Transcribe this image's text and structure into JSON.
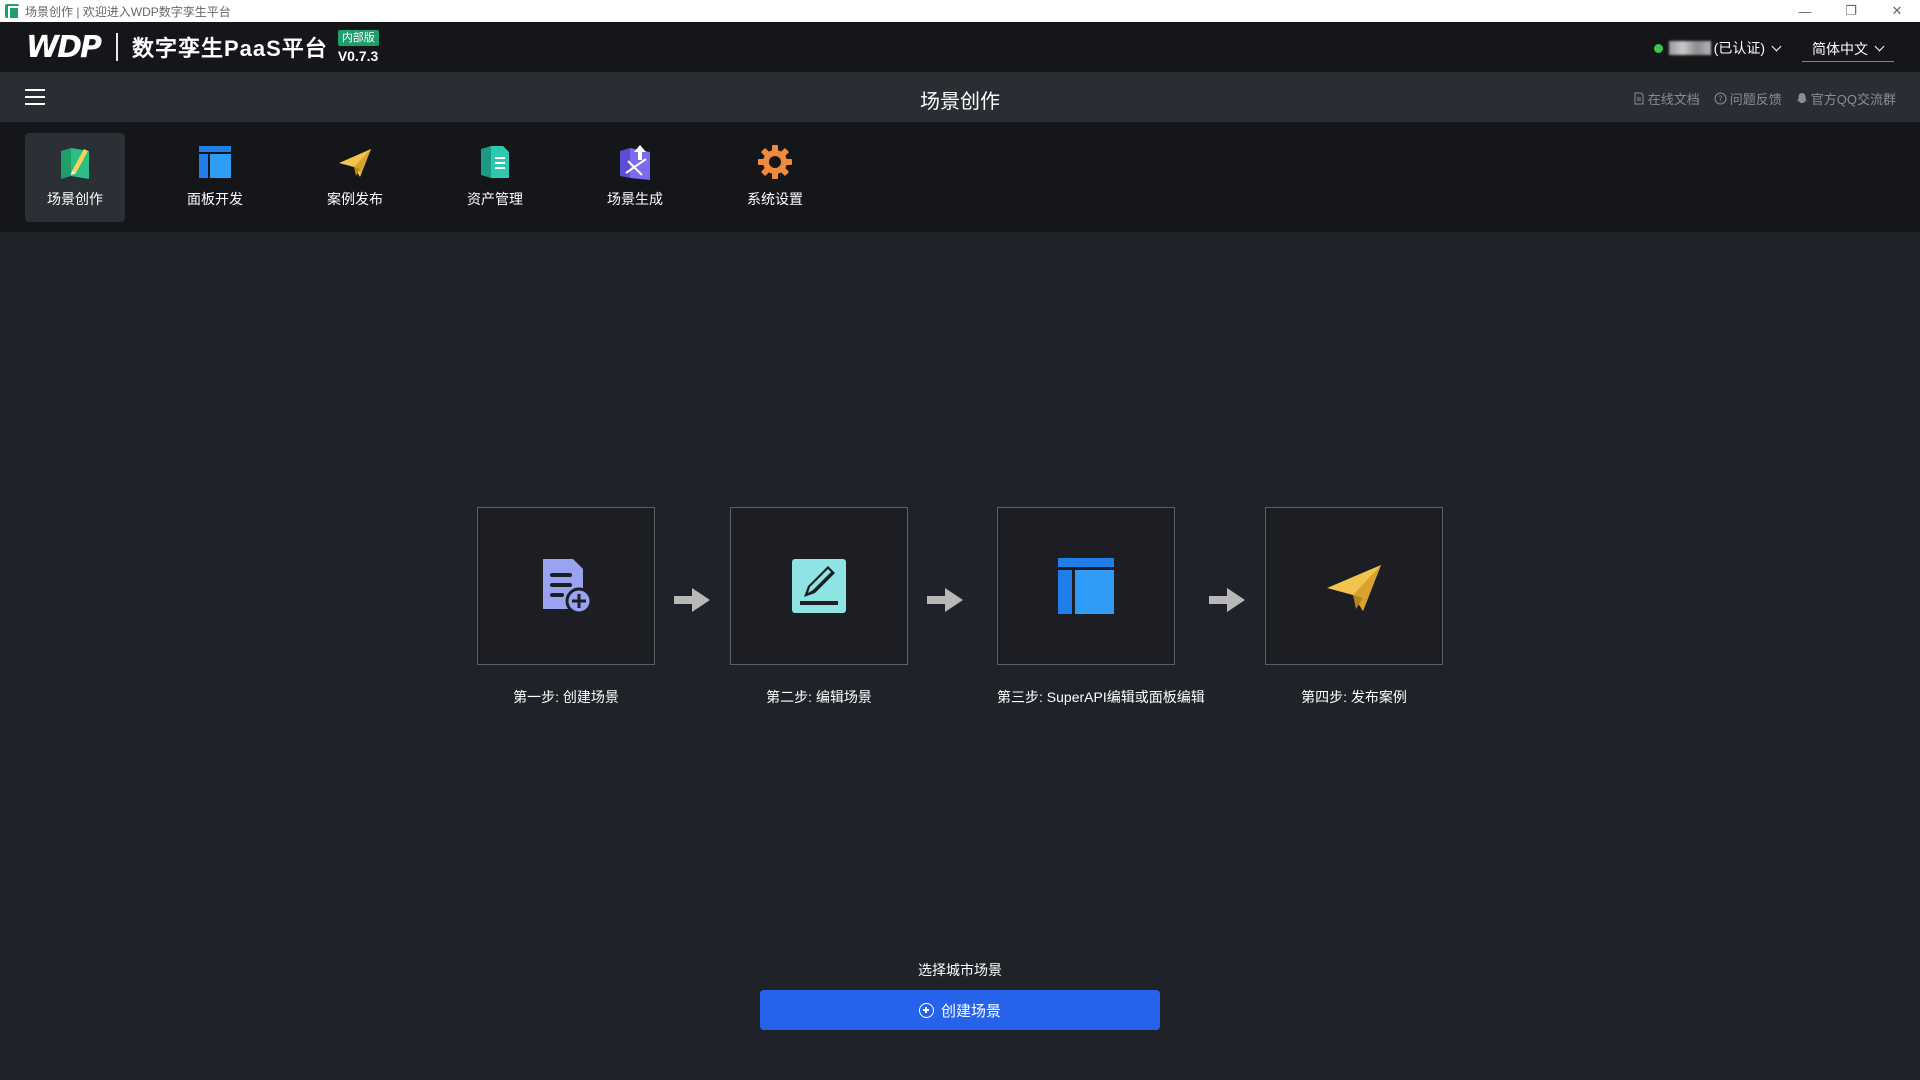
{
  "window": {
    "title": "场景创作 | 欢迎进入WDP数字孪生平台",
    "controls": [
      "—",
      "❐",
      "✕"
    ]
  },
  "header": {
    "logo_text": "WDP",
    "platform_name": "数字孪生PaaS平台",
    "badge": "内部版",
    "version": "V0.7.3",
    "user_status_text": "(已认证)",
    "language": "简体中文",
    "status_color": "#3ec646"
  },
  "subbar": {
    "page_title": "场景创作",
    "links": [
      {
        "label": "在线文档",
        "icon": "document-icon"
      },
      {
        "label": "问题反馈",
        "icon": "question-icon"
      },
      {
        "label": "官方QQ交流群",
        "icon": "qq-icon"
      }
    ]
  },
  "toolbar": {
    "items": [
      {
        "label": "场景创作",
        "icon": "scene-create-icon",
        "active": true
      },
      {
        "label": "面板开发",
        "icon": "panel-dev-icon",
        "active": false
      },
      {
        "label": "案例发布",
        "icon": "publish-icon",
        "active": false
      },
      {
        "label": "资产管理",
        "icon": "asset-icon",
        "active": false
      },
      {
        "label": "场景生成",
        "icon": "scene-gen-icon",
        "active": false
      },
      {
        "label": "系统设置",
        "icon": "settings-icon",
        "active": false
      }
    ]
  },
  "steps": [
    {
      "label": "第一步: 创建场景",
      "icon": "create-doc-icon"
    },
    {
      "label": "第二步: 编辑场景",
      "icon": "edit-icon"
    },
    {
      "label": "第三步: SuperAPI编辑或面板编辑",
      "icon": "layout-icon"
    },
    {
      "label": "第四步: 发布案例",
      "icon": "paper-plane-icon"
    }
  ],
  "main": {
    "select_label": "选择城市场景",
    "create_button": "创建场景",
    "accent_color": "#2563eb"
  }
}
